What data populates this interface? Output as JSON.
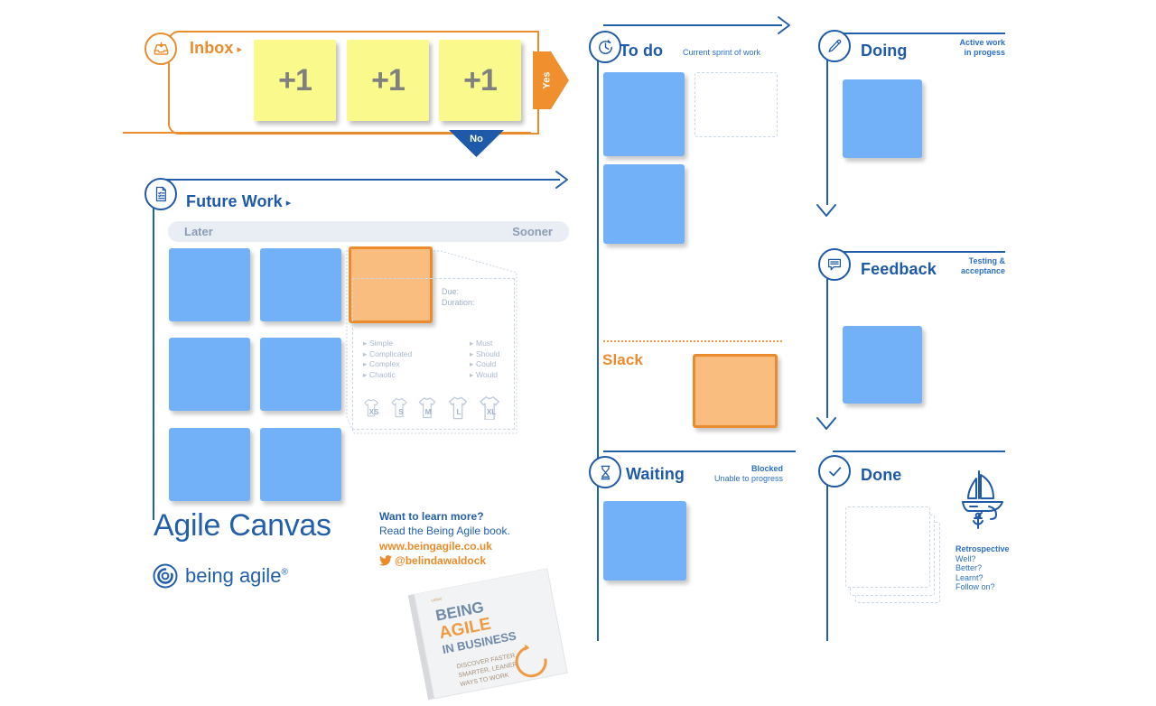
{
  "meta": {
    "title": "Agile Canvas"
  },
  "inbox": {
    "label": "Inbox",
    "caret": "▸",
    "icon": "inbox-tray-icon",
    "stickies": [
      {
        "text": "+1"
      },
      {
        "text": "+1"
      },
      {
        "text": "+1"
      }
    ],
    "yes_label": "Yes",
    "no_label": "No",
    "accent": "#ea8c2c"
  },
  "future_work": {
    "label": "Future Work",
    "caret": "▸",
    "icon": "checklist-document-icon",
    "timebar": {
      "left_label": "Later",
      "right_label": "Sooner"
    },
    "cards": [
      {
        "type": "blue"
      },
      {
        "type": "blue"
      },
      {
        "type": "orange"
      },
      {
        "type": "blue"
      },
      {
        "type": "blue"
      },
      {
        "type": "blue"
      },
      {
        "type": "blue"
      }
    ],
    "detail": {
      "due_label": "Due:",
      "duration_label": "Duration:",
      "complexity": [
        "Simple",
        "Complicated",
        "Complex",
        "Chaotic"
      ],
      "moscow": [
        "Must",
        "Should",
        "Could",
        "Would"
      ],
      "sizes": [
        "XS",
        "S",
        "M",
        "L",
        "XL"
      ]
    }
  },
  "todo": {
    "label": "To do",
    "icon": "clock-icon",
    "subtitle": "Current sprint of work",
    "cards": [
      {
        "type": "blue"
      },
      {
        "type": "ghost"
      },
      {
        "type": "blue"
      }
    ]
  },
  "slack": {
    "label": "Slack",
    "accent": "#ea8c2c",
    "cards": [
      {
        "type": "orange"
      }
    ]
  },
  "waiting": {
    "label": "Waiting",
    "icon": "hourglass-icon",
    "subtitle_bold": "Blocked",
    "subtitle": "Unable to progress",
    "cards": [
      {
        "type": "blue"
      }
    ]
  },
  "doing": {
    "label": "Doing",
    "icon": "pencil-icon",
    "subtitle_line1": "Active work",
    "subtitle_line2": "in progess",
    "cards": [
      {
        "type": "blue"
      }
    ]
  },
  "feedback": {
    "label": "Feedback",
    "icon": "speech-bubble-icon",
    "subtitle_line1": "Testing &",
    "subtitle_line2": "acceptance",
    "cards": [
      {
        "type": "blue"
      }
    ]
  },
  "done": {
    "label": "Done",
    "icon": "check-circle-icon",
    "boat_icon": "sailboat-anchor-icon",
    "cards": [
      {
        "type": "ghost"
      },
      {
        "type": "ghost"
      },
      {
        "type": "ghost"
      }
    ],
    "retrospective": {
      "heading": "Retrospective",
      "items": [
        "Well?",
        "Better?",
        "Learnt?",
        "Follow on?"
      ]
    }
  },
  "branding": {
    "title": "Agile Canvas",
    "logo_text": "being agile",
    "logo_mark": "circle-swirl-icon",
    "registered": "®",
    "promo_heading": "Want to learn more?",
    "promo_line": "Read the Being Agile book.",
    "promo_url": "www.beingagile.co.uk",
    "promo_twitter": "@belindawaldock",
    "twitter_icon": "twitter-bird-icon",
    "book": {
      "line1": "BEING",
      "line2": "AGILE",
      "line3": "IN BUSINESS",
      "tag1": "DISCOVER FASTER,",
      "tag2": "SMARTER, LEANER",
      "tag3": "WAYS TO WORK"
    }
  },
  "colors": {
    "blue_card": "#72b1f7",
    "orange_card": "#f9bd80",
    "orange_border": "#ec8b2e",
    "sticky": "#fafa8c",
    "accent_blue": "#2360ab",
    "accent_orange": "#ea8c2c",
    "timebar": "#e9eef5"
  }
}
